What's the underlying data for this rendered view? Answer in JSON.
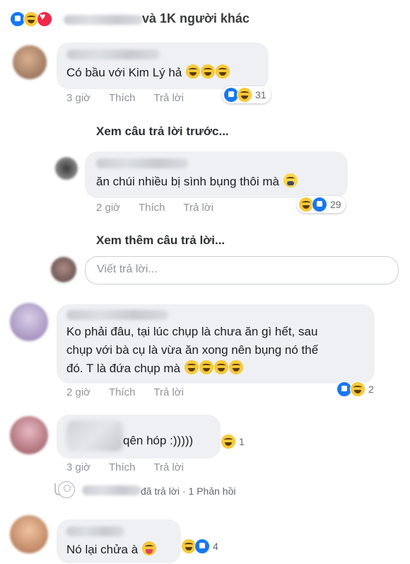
{
  "top_bar": {
    "likes_text": "và 1K người khác"
  },
  "comments": [
    {
      "text": "Có bầu với Kim Lý hả",
      "time": "3 giờ",
      "like": "Thích",
      "reply": "Trả lời",
      "reaction_count": "31"
    },
    {
      "text": "ăn chúi nhiều bị sình bụng thôi mà",
      "time": "2 giờ",
      "like": "Thích",
      "reply": "Trả lời",
      "reaction_count": "29"
    },
    {
      "text_line1": "Ko phải đâu, tại lúc chụp là chưa ăn gì hết, sau",
      "text_line2": "chụp với bà cụ là vừa ăn xong nên bụng nó thế",
      "text_line3": "đó. T là đứa chụp mà",
      "time": "2 giờ",
      "like": "Thích",
      "reply": "Trả lời",
      "reaction_count": "2"
    },
    {
      "text": "qên hóp :)))))",
      "time": "3 giờ",
      "like": "Thích",
      "reply": "Trả lời",
      "reaction_count": "1"
    },
    {
      "text": "Nó lại chửa à",
      "reaction_count": "4"
    }
  ],
  "prev_replies": "Xem câu trả lời trước...",
  "more_replies": "Xem thêm câu trả lời...",
  "reply_input": {
    "placeholder": "Viết trả lời..."
  },
  "replied_summary": {
    "action": "đã trả lời",
    "separator": "·",
    "count_text": "1 Phản hồi"
  },
  "colors": {
    "like": "#1877f2",
    "haha": "#f7c93a",
    "love": "#f0284a",
    "bubble": "#eef0f3",
    "meta": "#90949c"
  }
}
